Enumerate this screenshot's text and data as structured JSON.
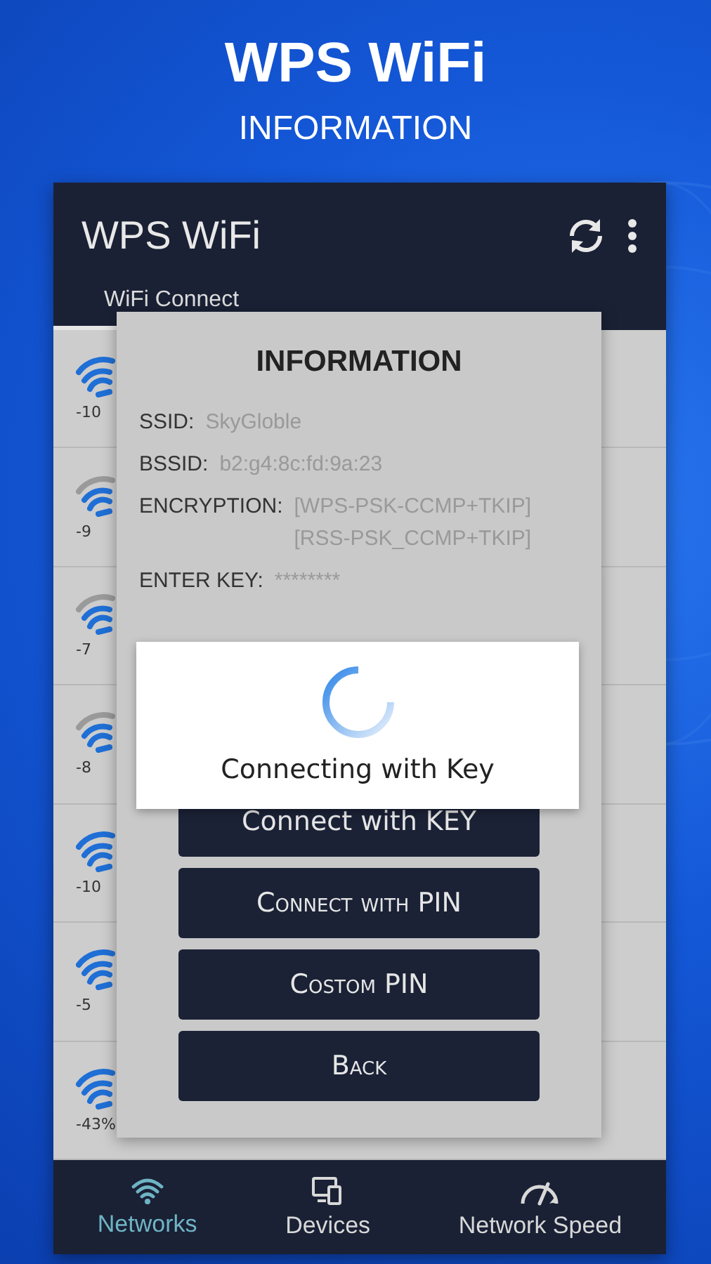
{
  "header": {
    "title": "WPS WiFi",
    "subtitle": "INFORMATION"
  },
  "app_bar": {
    "title": "WPS WiFi"
  },
  "tabs": [
    {
      "label": "WiFi Connect",
      "selected": true
    }
  ],
  "networks": [
    {
      "signal": "-10",
      "kind": "strong"
    },
    {
      "signal": "-9",
      "kind": "weak"
    },
    {
      "signal": "-7",
      "kind": "weak"
    },
    {
      "signal": "-8",
      "kind": "weak"
    },
    {
      "signal": "-10",
      "kind": "strong"
    },
    {
      "signal": "-5",
      "kind": "strong"
    },
    {
      "signal": "-43%",
      "kind": "strong"
    }
  ],
  "dialog": {
    "title": "INFORMATION",
    "fields": [
      {
        "label": "SSID:",
        "lines": [
          "SkyGloble"
        ]
      },
      {
        "label": "BSSID:",
        "lines": [
          "b2:g4:8c:fd:9a:23"
        ]
      },
      {
        "label": "ENCRYPTION:",
        "lines": [
          "[WPS-PSK-CCMP+TKIP]",
          "[RSS-PSK_CCMP+TKIP]"
        ]
      },
      {
        "label": "ENTER KEY:",
        "lines": [
          "********"
        ]
      }
    ],
    "buttons": [
      {
        "label": "Connect with KEY",
        "small_caps": false
      },
      {
        "label": "Connect with PIN",
        "small_caps": true
      },
      {
        "label": "Costom PIN",
        "small_caps": true
      },
      {
        "label": "Back",
        "small_caps": true
      }
    ]
  },
  "progress": {
    "message": "Connecting with Key"
  },
  "bottom_nav": [
    {
      "label": "Networks",
      "selected": true
    },
    {
      "label": "Devices",
      "selected": false
    },
    {
      "label": "Network Speed",
      "selected": false
    }
  ]
}
